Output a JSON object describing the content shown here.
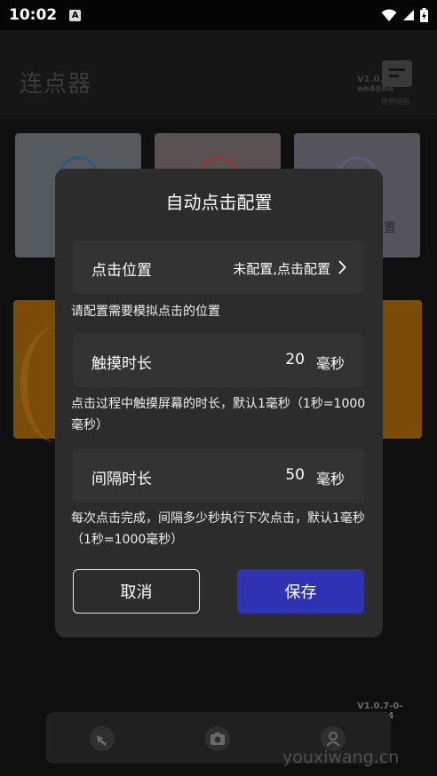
{
  "status_bar": {
    "time": "10:02",
    "notification_icon_letter": "A",
    "icons": [
      "wifi-icon",
      "signal-icon",
      "battery-charging-icon"
    ]
  },
  "header": {
    "title": "连点器",
    "version": "V1.0.7-0-ee4864",
    "help_label": "使用说明"
  },
  "background": {
    "cards": [
      "",
      "",
      "置"
    ],
    "version": "V1.0.7-0-ee4864",
    "nav_icons": [
      "tap-icon",
      "camera-icon",
      "profile-icon"
    ],
    "watermark": "youxiwang.cn"
  },
  "dialog": {
    "title": "自动点击配置",
    "click_position": {
      "label": "点击位置",
      "value": "未配置,点击配置"
    },
    "click_position_hint": "请配置需要模拟点击的位置",
    "touch_duration": {
      "label": "触摸时长",
      "value": "20",
      "unit": "毫秒"
    },
    "touch_duration_hint": "点击过程中触摸屏幕的时长，默认1毫秒（1秒=1000毫秒）",
    "interval_duration": {
      "label": "间隔时长",
      "value": "50",
      "unit": "毫秒"
    },
    "interval_duration_hint": "每次点击完成，间隔多少秒执行下次点击，默认1毫秒（1秒=1000毫秒）",
    "cancel_label": "取消",
    "save_label": "保存"
  },
  "colors": {
    "dialog_bg": "#2c2c2d",
    "row_bg": "#333334",
    "save_button": "#2f33b3",
    "orange_card": "#7a4c07"
  }
}
